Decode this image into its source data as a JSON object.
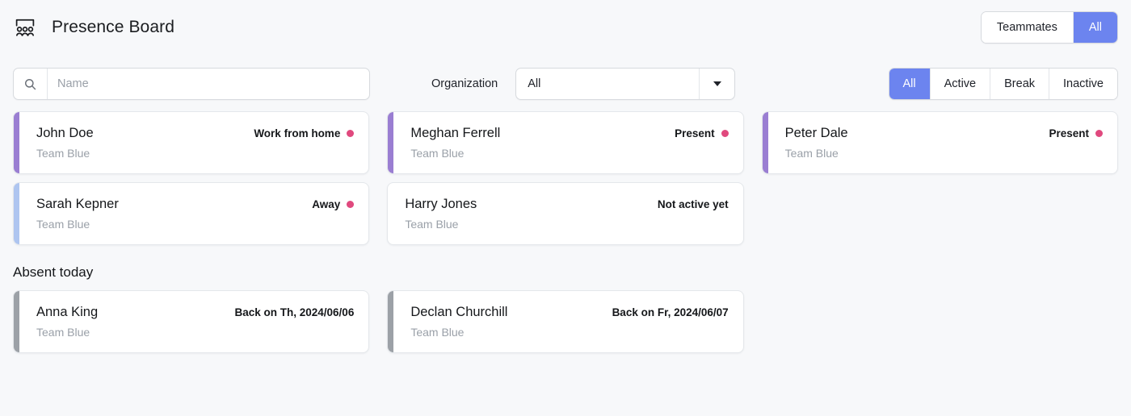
{
  "header": {
    "icon": "people-group-icon",
    "title": "Presence Board",
    "scope_toggle": {
      "options": [
        {
          "label": "Teammates",
          "selected": false
        },
        {
          "label": "All",
          "selected": true
        }
      ]
    }
  },
  "filters": {
    "search": {
      "icon": "search-icon",
      "value": "",
      "placeholder": "Name"
    },
    "organization": {
      "label": "Organization",
      "value": "All",
      "caret_icon": "chevron-down-icon"
    },
    "status_tabs": [
      {
        "label": "All",
        "selected": true
      },
      {
        "label": "Active",
        "selected": false
      },
      {
        "label": "Break",
        "selected": false
      },
      {
        "label": "Inactive",
        "selected": false
      }
    ]
  },
  "colors": {
    "accent_blue": "#6c84ef",
    "accent_purple": "#9a7ed2",
    "accent_lightblue": "#aec5f0",
    "accent_gray": "#9ca1a7",
    "status_dot_pink": "#e0497e",
    "page_background": "#f7f8fa"
  },
  "present_cards": [
    {
      "name": "John Doe",
      "team": "Team Blue",
      "status": "Work from home",
      "accent": "purple",
      "has_dot": true
    },
    {
      "name": "Meghan Ferrell",
      "team": "Team Blue",
      "status": "Present",
      "accent": "purple",
      "has_dot": true
    },
    {
      "name": "Peter Dale",
      "team": "Team Blue",
      "status": "Present",
      "accent": "purple",
      "has_dot": true
    },
    {
      "name": "Sarah Kepner",
      "team": "Team Blue",
      "status": "Away",
      "accent": "lightblue",
      "has_dot": true
    },
    {
      "name": "Harry Jones",
      "team": "Team Blue",
      "status": "Not active yet",
      "accent": "none",
      "has_dot": false
    }
  ],
  "absent_section": {
    "title": "Absent today",
    "cards": [
      {
        "name": "Anna King",
        "team": "Team Blue",
        "status": "Back on Th, 2024/06/06",
        "accent": "gray",
        "has_dot": false
      },
      {
        "name": "Declan Churchill",
        "team": "Team Blue",
        "status": "Back on Fr, 2024/06/07",
        "accent": "gray",
        "has_dot": false
      }
    ]
  }
}
